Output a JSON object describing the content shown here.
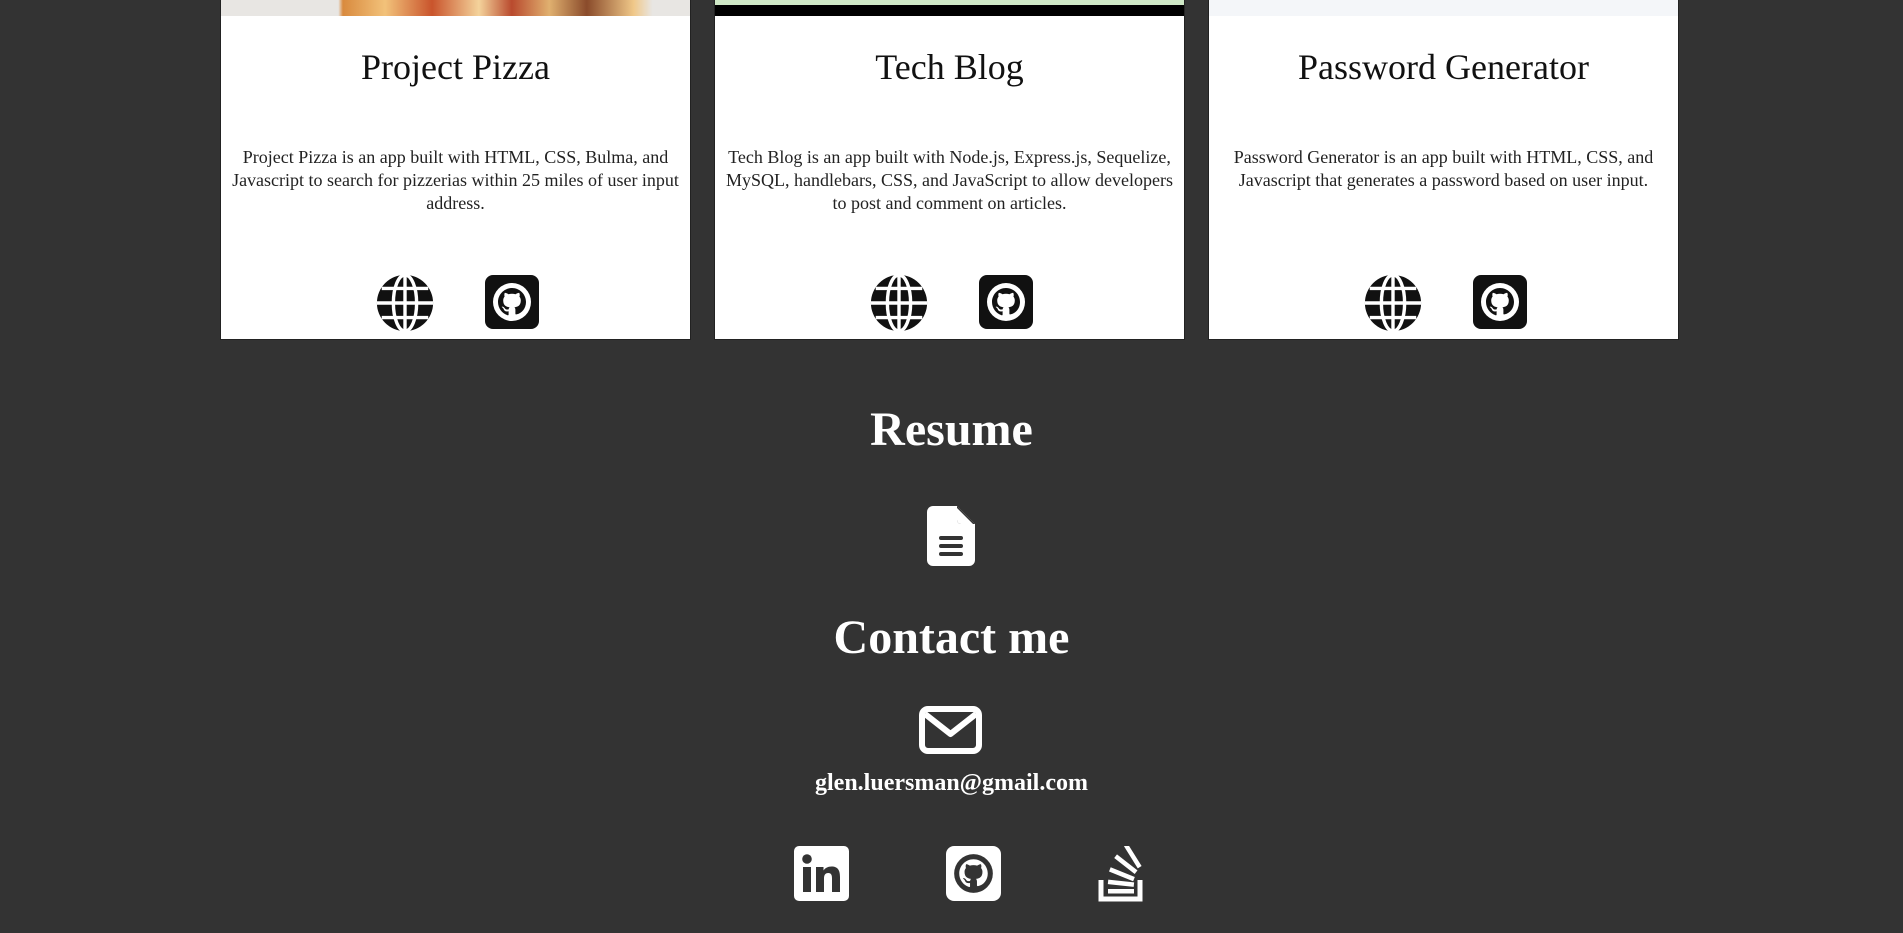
{
  "projects": [
    {
      "title": "Project Pizza",
      "description": "Project Pizza is an app built with HTML, CSS, Bulma, and Javascript to search for pizzerias within 25 miles of user input address.",
      "links": {
        "deployed_icon": "globe-icon",
        "repo_icon": "github-icon"
      }
    },
    {
      "title": "Tech Blog",
      "description": "Tech Blog is an app built with Node.js, Express.js, Sequelize, MySQL, handlebars, CSS, and JavaScript to allow developers to post and comment on articles.",
      "links": {
        "deployed_icon": "globe-icon",
        "repo_icon": "github-icon"
      }
    },
    {
      "title": "Password Generator",
      "description": "Password Generator is an app built with HTML, CSS, and Javascript that generates a password based on user input.",
      "links": {
        "deployed_icon": "globe-icon",
        "repo_icon": "github-icon"
      }
    }
  ],
  "resume": {
    "title": "Resume",
    "icon": "file-icon"
  },
  "contact": {
    "title": "Contact me",
    "icon": "envelope-icon",
    "email": "glen.luersman@gmail.com",
    "socials": [
      {
        "icon": "linkedin-icon"
      },
      {
        "icon": "github-icon"
      },
      {
        "icon": "stack-overflow-icon"
      }
    ]
  },
  "colors": {
    "background": "#333333",
    "card": "#ffffff",
    "icon_dark": "#111111",
    "text_light": "#ffffff"
  }
}
